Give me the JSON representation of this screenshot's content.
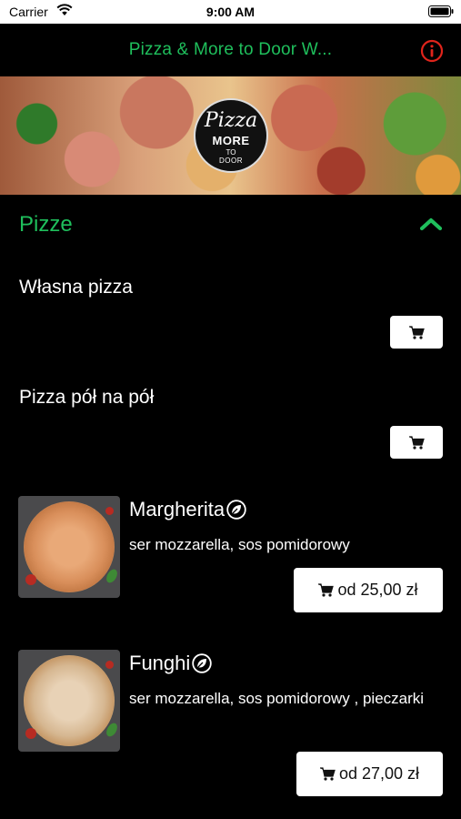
{
  "status_bar": {
    "carrier": "Carrier",
    "time": "9:00 AM"
  },
  "nav": {
    "title": "Pizza & More to Door W..."
  },
  "banner": {
    "logo": {
      "line1": "Pizza",
      "line2": "MORE",
      "line3": "TO",
      "line4": "DOOR"
    }
  },
  "section": {
    "title": "Pizze"
  },
  "items": [
    {
      "name": "Własna pizza"
    },
    {
      "name": "Pizza pół na pół"
    }
  ],
  "products": [
    {
      "name": "Margherita",
      "description": " ser mozzarella, sos pomidorowy",
      "price": "od 25,00 zł"
    },
    {
      "name": "Funghi",
      "description": " ser mozzarella, sos pomidorowy , pieczarki",
      "price": "od 27,00 zł"
    }
  ],
  "colors": {
    "accent": "#1fbf5c",
    "info_icon": "#e0241b",
    "background": "#000000"
  },
  "icons": {
    "wifi": "wifi-icon",
    "battery": "battery-icon",
    "info": "info-icon",
    "collapse": "chevron-up-icon",
    "cart": "cart-icon",
    "vegetarian": "leaf-icon"
  }
}
